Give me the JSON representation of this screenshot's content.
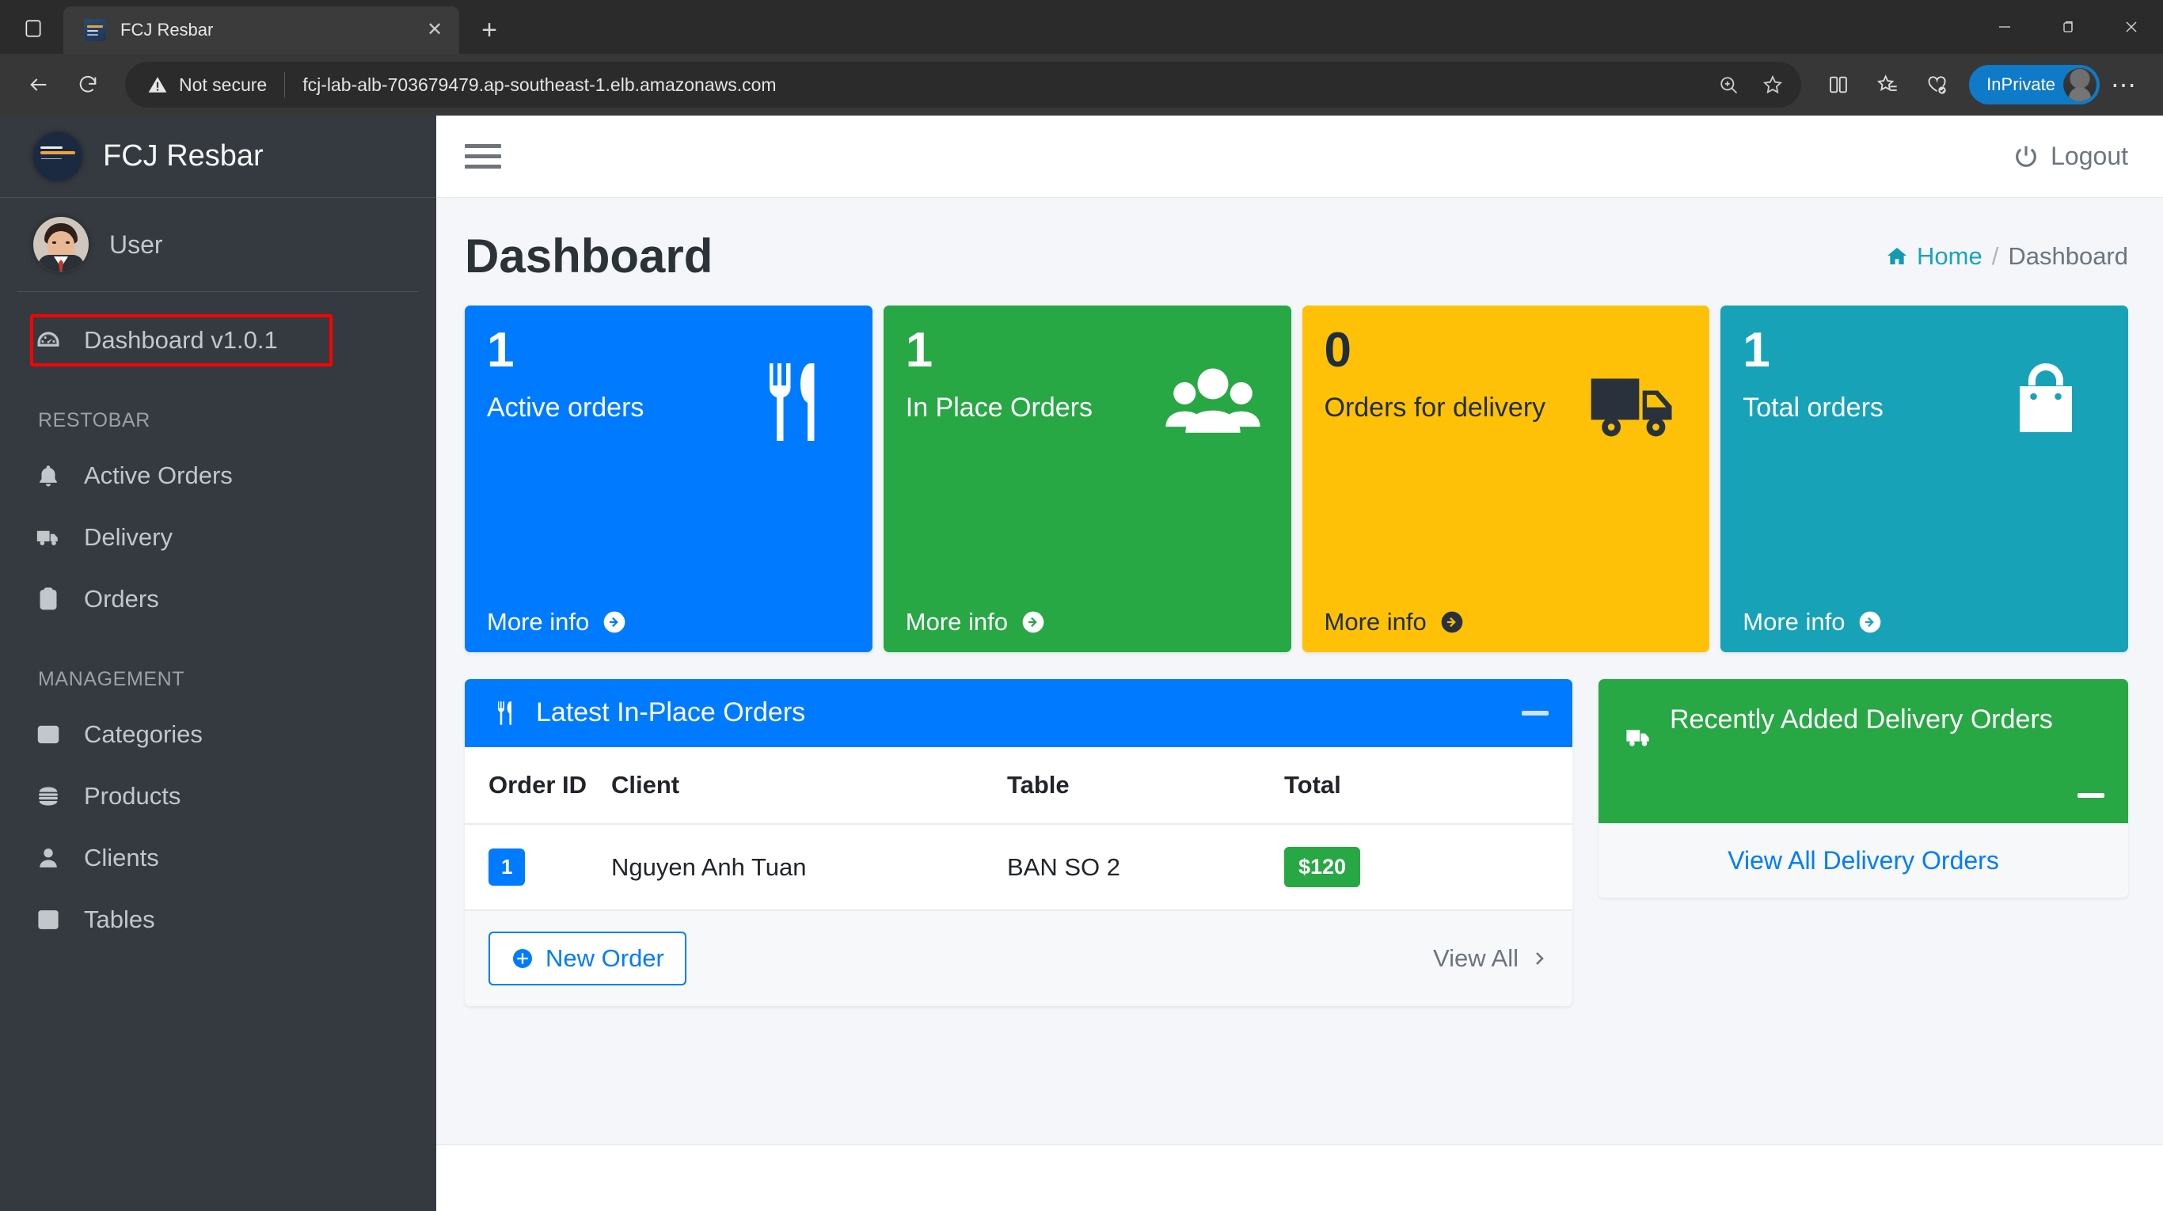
{
  "browser": {
    "tab": {
      "title": "FCJ Resbar",
      "favicon": "site-favicon",
      "close_label": "✕"
    },
    "new_tab_label": "+",
    "security_label": "Not secure",
    "url": "fcj-lab-alb-703679479.ap-southeast-1.elb.amazonaws.com",
    "profile_label": "InPrivate",
    "window": {
      "minimize": "–",
      "restore": "❐",
      "close": "✕"
    },
    "overflow_label": "⋯"
  },
  "sidebar": {
    "brand": "FCJ Resbar",
    "user": "User",
    "dashboard": {
      "label": "Dashboard v1.0.1",
      "icon": "tachometer-icon",
      "highlight_color": "#ff0000"
    },
    "sections": [
      {
        "header": "RESTOBAR",
        "items": [
          {
            "label": "Active Orders",
            "icon": "bell-icon"
          },
          {
            "label": "Delivery",
            "icon": "truck-icon"
          },
          {
            "label": "Orders",
            "icon": "clipboard-icon"
          }
        ]
      },
      {
        "header": "MANAGEMENT",
        "items": [
          {
            "label": "Categories",
            "icon": "list-icon"
          },
          {
            "label": "Products",
            "icon": "burger-icon"
          },
          {
            "label": "Clients",
            "icon": "user-icon"
          },
          {
            "label": "Tables",
            "icon": "grid-icon"
          }
        ]
      }
    ]
  },
  "topbar": {
    "menu_toggle": "hamburger-icon",
    "logout": "Logout"
  },
  "page": {
    "title": "Dashboard",
    "breadcrumb": {
      "home": "Home",
      "separator": "/",
      "current": "Dashboard"
    }
  },
  "cards": [
    {
      "value": "1",
      "label": "Active orders",
      "more": "More info",
      "color": "#007bff",
      "icon": "cutlery-icon"
    },
    {
      "value": "1",
      "label": "In Place Orders",
      "more": "More info",
      "color": "#28a745",
      "icon": "users-icon"
    },
    {
      "value": "0",
      "label": "Orders for delivery",
      "more": "More info",
      "color": "#ffc107",
      "icon": "truck-icon"
    },
    {
      "value": "1",
      "label": "Total orders",
      "more": "More info",
      "color": "#17a2b8",
      "icon": "shopping-bag-icon"
    }
  ],
  "inplace_panel": {
    "title": "Latest In-Place Orders",
    "icon": "cutlery-icon",
    "collapse": "–",
    "columns": [
      "Order ID",
      "Client",
      "Table",
      "Total"
    ],
    "rows": [
      {
        "id": "1",
        "client": "Nguyen Anh Tuan",
        "table": "BAN SO 2",
        "total": "$120"
      }
    ],
    "new_order": "New Order",
    "view_all": "View All"
  },
  "delivery_panel": {
    "title": "Recently Added Delivery Orders",
    "icon": "truck-icon",
    "collapse": "–",
    "view_all": "View All Delivery Orders"
  }
}
